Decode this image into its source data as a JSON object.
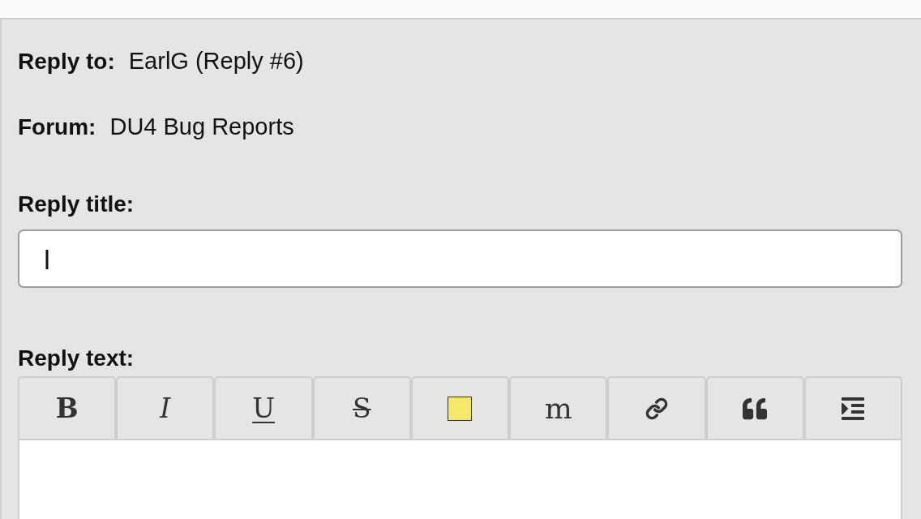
{
  "meta": [
    {
      "label": "Reply to:",
      "value": "EarlG (Reply #6)"
    },
    {
      "label": "Forum:",
      "value": "DU4 Bug Reports"
    }
  ],
  "title_field": {
    "label": "Reply title:",
    "focused": true
  },
  "text_field": {
    "label": "Reply text:"
  },
  "toolbar": [
    {
      "kind": "bold",
      "label": "B"
    },
    {
      "kind": "italic",
      "label": "I"
    },
    {
      "kind": "underline",
      "label": "U"
    },
    {
      "kind": "strike",
      "label": "S"
    },
    {
      "kind": "highlight"
    },
    {
      "kind": "mono",
      "label": "m"
    },
    {
      "kind": "link"
    },
    {
      "kind": "quote"
    },
    {
      "kind": "indent"
    }
  ]
}
